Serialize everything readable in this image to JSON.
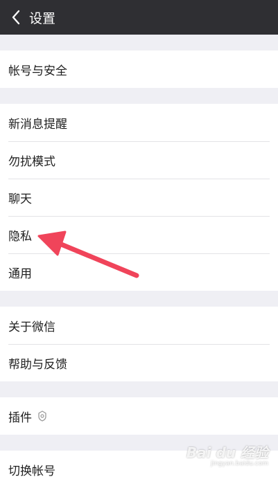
{
  "header": {
    "title": "设置"
  },
  "groups": {
    "account": {
      "items": [
        "帐号与安全"
      ]
    },
    "main": {
      "items": [
        "新消息提醒",
        "勿扰模式",
        "聊天",
        "隐私",
        "通用"
      ]
    },
    "about": {
      "items": [
        "关于微信",
        "帮助与反馈"
      ]
    },
    "plugins": {
      "items": [
        "插件"
      ]
    },
    "switch": {
      "items": [
        "切换帐号"
      ]
    }
  },
  "icons": {
    "back": "chevron-left-icon",
    "plugin": "plugin-badge-icon"
  },
  "annotation": {
    "color": "#f0445a",
    "target": "隐私"
  },
  "watermark": {
    "main": "Bai du 经验",
    "sub": "jingyan.baidu.com"
  },
  "colors": {
    "header_bg": "#2f2f33",
    "page_bg": "#efeff4",
    "arrow": "#f0445a"
  }
}
